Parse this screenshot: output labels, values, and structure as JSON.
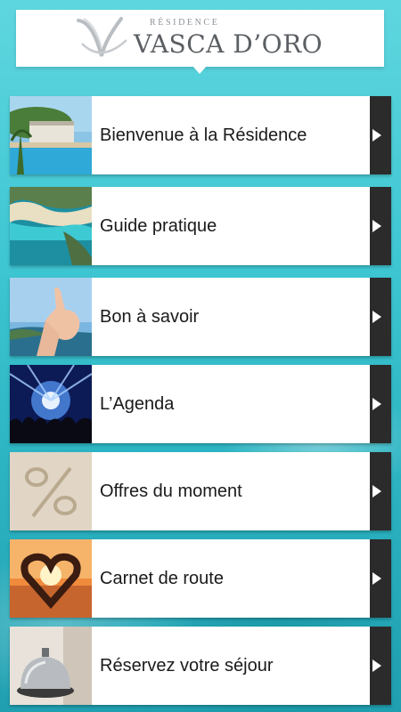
{
  "header": {
    "logo_small": "RÉSIDENCE",
    "logo_big": "VASCA D’ORO"
  },
  "menu": [
    {
      "label": "Bienvenue à la Résidence",
      "thumb": "resort-pool-photo"
    },
    {
      "label": "Guide pratique",
      "thumb": "aerial-coast-photo"
    },
    {
      "label": "Bon à savoir",
      "thumb": "thumbs-up-photo"
    },
    {
      "label": "L’Agenda",
      "thumb": "concert-photo"
    },
    {
      "label": "Offres du moment",
      "thumb": "sand-percent-photo"
    },
    {
      "label": "Carnet de route",
      "thumb": "heart-hands-sunset-photo"
    },
    {
      "label": "Réservez votre séjour",
      "thumb": "reception-bell-photo"
    }
  ],
  "colors": {
    "background": "#3fc7d3",
    "card": "#ffffff",
    "arrow_bar": "#2b2b2b",
    "text": "#1a1a1a"
  }
}
